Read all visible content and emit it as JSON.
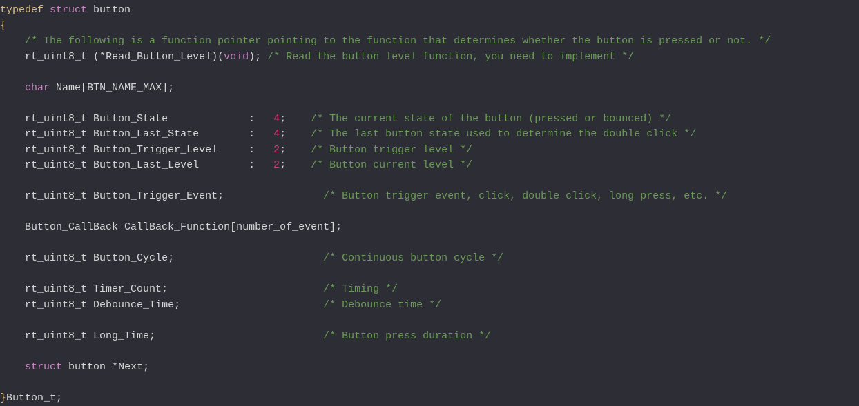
{
  "lines": {
    "l1_typedef": "typedef",
    "l1_struct": "struct",
    "l1_name": " button",
    "l2_brace": "{",
    "l3_comment": "/* The following is a function pointer pointing to the function that determines whether the button is pressed or not. */",
    "l4_type": "rt_uint8_t ",
    "l4_lparen": "(",
    "l4_star": "*",
    "l4_fname": "Read_Button_Level",
    "l4_rparen": ")",
    "l4_lparen2": "(",
    "l4_void": "void",
    "l4_rparen2": ")",
    "l4_semi": ";",
    "l4_comment": " /* Read the button level function, you need to implement */",
    "l6_char": "char",
    "l6_name": " Name",
    "l6_bracket": "[",
    "l6_max": "BTN_NAME_MAX",
    "l6_rbracket": "]",
    "l6_semi": ";",
    "l8_type": "rt_uint8_t ",
    "l8_field": "Button_State             ",
    "l8_colon": ":   ",
    "l8_num": "4",
    "l8_semi": ";    ",
    "l8_comment": "/* The current state of the button (pressed or bounced) */",
    "l9_type": "rt_uint8_t ",
    "l9_field": "Button_Last_State        ",
    "l9_colon": ":   ",
    "l9_num": "4",
    "l9_semi": ";    ",
    "l9_comment": "/* The last button state used to determine the double click */",
    "l10_type": "rt_uint8_t ",
    "l10_field": "Button_Trigger_Level     ",
    "l10_colon": ":   ",
    "l10_num": "2",
    "l10_semi": ";    ",
    "l10_comment": "/* Button trigger level */",
    "l11_type": "rt_uint8_t ",
    "l11_field": "Button_Last_Level        ",
    "l11_colon": ":   ",
    "l11_num": "2",
    "l11_semi": ";    ",
    "l11_comment": "/* Button current level */",
    "l13_type": "rt_uint8_t ",
    "l13_field": "Button_Trigger_Event",
    "l13_semi": ";                ",
    "l13_comment": "/* Button trigger event, click, double click, long press, etc. */",
    "l15_type": "Button_CallBack ",
    "l15_field": "CallBack_Function",
    "l15_bracket": "[",
    "l15_noe": "number_of_event",
    "l15_rbracket": "]",
    "l15_semi": ";",
    "l17_type": "rt_uint8_t ",
    "l17_field": "Button_Cycle",
    "l17_semi": ";                        ",
    "l17_comment": "/* Continuous button cycle */",
    "l19_type": "rt_uint8_t ",
    "l19_field": "Timer_Count",
    "l19_semi": ";                         ",
    "l19_comment": "/* Timing */",
    "l20_type": "rt_uint8_t ",
    "l20_field": "Debounce_Time",
    "l20_semi": ";                       ",
    "l20_comment": "/* Debounce time */",
    "l22_type": "rt_uint8_t ",
    "l22_field": "Long_Time",
    "l22_semi": ";                           ",
    "l22_comment": "/* Button press duration */",
    "l24_struct": "struct",
    "l24_btn": " button ",
    "l24_star": "*",
    "l24_next": "Next",
    "l24_semi": ";",
    "l26_brace": "}",
    "l26_typename": "Button_t",
    "l26_semi": ";"
  }
}
